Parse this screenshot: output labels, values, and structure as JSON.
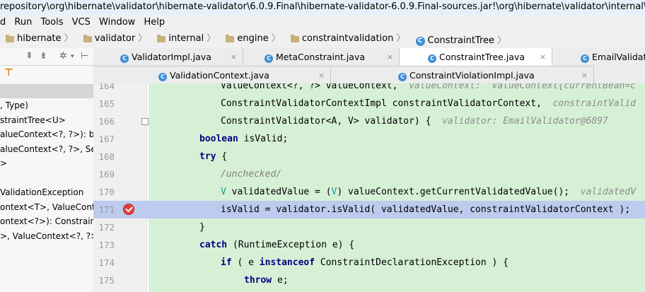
{
  "title": "repository\\org\\hibernate\\validator\\hibernate-validator\\6.0.9.Final\\hibernate-validator-6.0.9.Final-sources.jar!\\org\\hibernate\\validator\\internal\\engine\\constraintvalidation",
  "menu": [
    "d",
    "Run",
    "Tools",
    "VCS",
    "Window",
    "Help"
  ],
  "breadcrumbs": [
    "hibernate",
    "validator",
    "internal",
    "engine",
    "constraintvalidation",
    "ConstraintTree"
  ],
  "tabs_row1": [
    "ValidatorImpl.java",
    "MetaConstraint.java",
    "ConstraintTree.java",
    "EmailValidator"
  ],
  "tabs_row2": [
    "ValidationContext.java",
    "ConstraintViolationImpl.java"
  ],
  "left_panel": [
    ", Type)",
    "straintTree<U>",
    "alueContext<?, ?>): boo",
    "alueContext<?, ?>, Set<",
    ">",
    "",
    "ValidationException",
    "ontext<T>, ValueContex",
    "ontext<?>): ConstraintV",
    ">, ValueContext<?, ?>,"
  ],
  "editor": {
    "lines": [
      {
        "n": "164",
        "parts": [
          {
            "t": "ValueContext<?, ?> valueContext,  ",
            "c": ""
          },
          {
            "t": "valueContext: \"ValueContext{currentBean=c",
            "c": "hint"
          }
        ]
      },
      {
        "n": "165",
        "parts": [
          {
            "t": "ConstraintValidatorContextImpl constraintValidatorContext,  ",
            "c": ""
          },
          {
            "t": "constraintValid",
            "c": "hint"
          }
        ]
      },
      {
        "n": "166",
        "parts": [
          {
            "t": "ConstraintValidator<A, V> validator) {  ",
            "c": ""
          },
          {
            "t": "validator: EmailValidator@6897",
            "c": "hint"
          }
        ]
      },
      {
        "n": "167",
        "parts": [
          {
            "t": "boolean",
            "c": "kw"
          },
          {
            "t": " isValid;",
            "c": ""
          }
        ]
      },
      {
        "n": "168",
        "parts": [
          {
            "t": "try",
            "c": "kw"
          },
          {
            "t": " {",
            "c": ""
          }
        ]
      },
      {
        "n": "169",
        "parts": [
          {
            "t": "/unchecked/",
            "c": "cm"
          }
        ]
      },
      {
        "n": "170",
        "parts": [
          {
            "t": "V",
            "c": "tp"
          },
          {
            "t": " validatedValue = (",
            "c": ""
          },
          {
            "t": "V",
            "c": "tp"
          },
          {
            "t": ") valueContext.getCurrentValidatedValue();  ",
            "c": ""
          },
          {
            "t": "validatedV",
            "c": "hint"
          }
        ]
      },
      {
        "n": "171",
        "parts": [
          {
            "t": "isValid = validator.isValid( validatedValue, constraintValidatorContext );",
            "c": ""
          }
        ]
      },
      {
        "n": "172",
        "parts": [
          {
            "t": "}",
            "c": ""
          }
        ]
      },
      {
        "n": "173",
        "parts": [
          {
            "t": "catch",
            "c": "kw"
          },
          {
            "t": " (RuntimeException e) {",
            "c": ""
          }
        ]
      },
      {
        "n": "174",
        "parts": [
          {
            "t": "if",
            "c": "kw"
          },
          {
            "t": " ( e ",
            "c": ""
          },
          {
            "t": "instanceof",
            "c": "kw"
          },
          {
            "t": " ConstraintDeclarationException ) {",
            "c": ""
          }
        ]
      },
      {
        "n": "175",
        "parts": [
          {
            "t": "throw",
            "c": "kw"
          },
          {
            "t": " e;",
            "c": ""
          }
        ]
      }
    ]
  },
  "colors": {
    "code_bg": "#d6f0d6",
    "current_line": "#bdcbee",
    "keyword": "#000080",
    "hint": "#8c8c8c"
  }
}
